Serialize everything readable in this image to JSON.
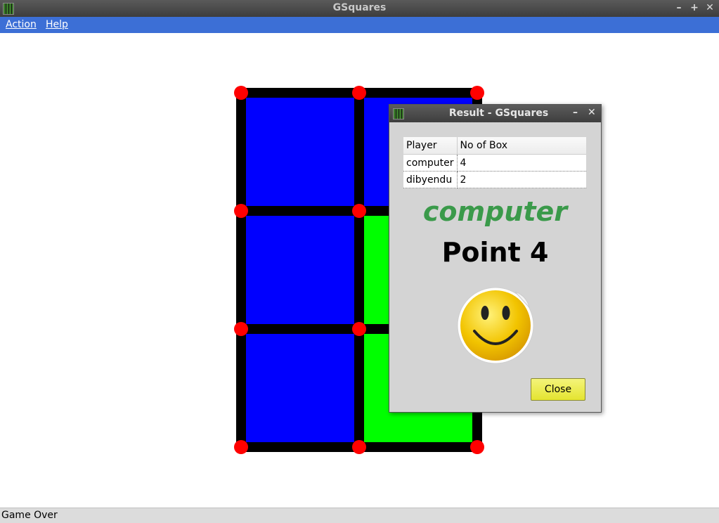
{
  "window": {
    "title": "GSquares",
    "minimize": "–",
    "maximize": "+",
    "close": "✕"
  },
  "menu": {
    "items": [
      {
        "label": "Action"
      },
      {
        "label": "Help"
      }
    ]
  },
  "board": {
    "rows": 3,
    "cols": 2,
    "cells": [
      [
        "blue",
        "blue"
      ],
      [
        "blue",
        "green"
      ],
      [
        "blue",
        "green"
      ]
    ],
    "colors": {
      "blue": "#0000ff",
      "green": "#00ff00",
      "line": "#000000",
      "dot": "#ff0000"
    }
  },
  "status": {
    "text": "Game Over"
  },
  "dialog": {
    "title": "Result - GSquares",
    "minimize": "–",
    "close": "✕",
    "table": {
      "headers": [
        "Player",
        "No of Box"
      ],
      "rows": [
        [
          "computer",
          "4"
        ],
        [
          "dibyendu",
          "2"
        ]
      ]
    },
    "winner": "computer",
    "points": "Point 4",
    "winner_color": "#3a9a4a",
    "icon": "smiley-icon",
    "close_label": "Close"
  }
}
